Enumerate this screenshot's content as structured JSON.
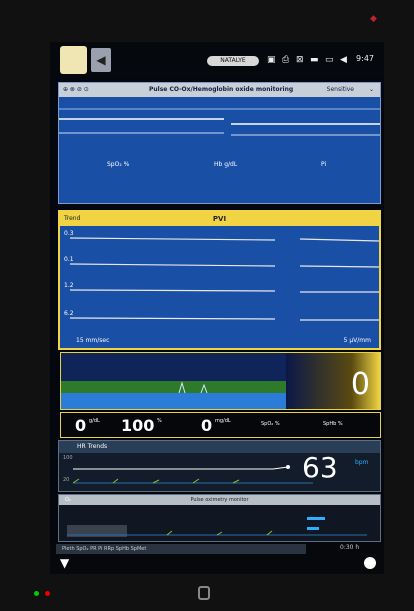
{
  "statusbar": {
    "account": "NATALYE",
    "time": "9:47",
    "icons": [
      "save-icon",
      "print-icon",
      "grid-icon",
      "battery-icon",
      "window-icon",
      "volume-icon"
    ]
  },
  "panel1": {
    "title": "Pulse CO-Ox/Hemoglobin oxide monitoring",
    "mode": "Sensitive",
    "legend": [
      "SpO₂ %",
      "Hb g/dL",
      "Pi"
    ]
  },
  "panel2": {
    "label": "Trend",
    "title": "PVI",
    "ylabels": [
      "0.3",
      "0.1",
      "1.2",
      "6.2"
    ],
    "speed_left": "15 mm/sec",
    "speed_right": "5 μV/mm"
  },
  "panel3": {
    "big_value": "0"
  },
  "readouts": [
    {
      "value": "0",
      "unit": "g/dL"
    },
    {
      "value": "100",
      "unit": "%"
    },
    {
      "value": "0",
      "unit": "mg/dL"
    },
    {
      "value": "SpO₂ %"
    },
    {
      "value": "SpHb %"
    }
  ],
  "hr": {
    "title": "HR Trends",
    "scale_top": "100",
    "scale_bottom": "20",
    "value": "63",
    "unit": "bpm"
  },
  "o2": {
    "label": "O₂",
    "title": "Pulse oximetry monitor"
  },
  "bottombar": {
    "tabs": "Pleth  SpO₂  PR  Pi  RRp  SpHb  SpMet",
    "zoom": "0:30 h"
  },
  "colors": {
    "accent_yellow": "#f0d443",
    "panel_blue": "#1a4fa6",
    "hr_blue": "#2ab0ff"
  }
}
